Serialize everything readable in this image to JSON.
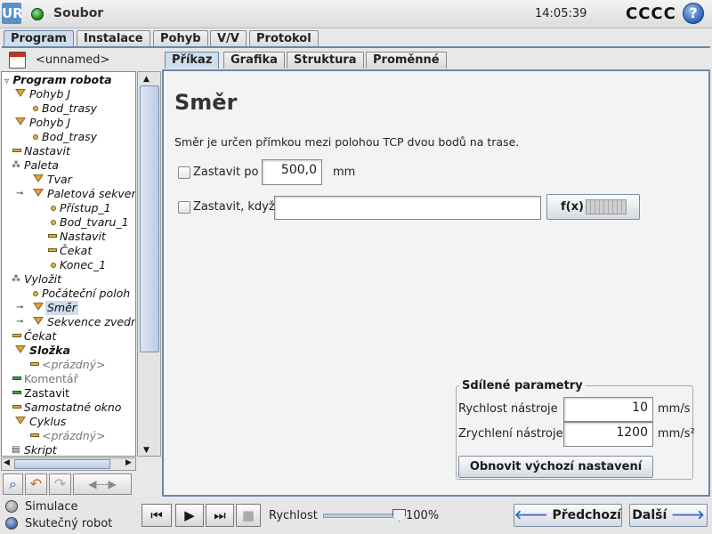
{
  "app": {
    "title": "Soubor",
    "clock": "14:05:39",
    "robot_name": "CCCC",
    "help": "?",
    "logo": "UR"
  },
  "main_tabs": [
    {
      "label": "Program",
      "active": true
    },
    {
      "label": "Instalace",
      "active": false
    },
    {
      "label": "Pohyb",
      "active": false
    },
    {
      "label": "V/V",
      "active": false
    },
    {
      "label": "Protokol",
      "active": false
    }
  ],
  "file": {
    "name": "<unnamed>"
  },
  "tree": [
    "Program robota",
    "Pohyb J",
    "Bod_trasy",
    "Pohyb J",
    "Bod_trasy",
    "Nastavit",
    "Paleta",
    "Tvar",
    "Paletová sekven",
    "Přístup_1",
    "Bod_tvaru_1",
    "Nastavit",
    "Čekat",
    "Konec_1",
    "Vyložit",
    "Počáteční poloh",
    "Směr",
    "Sekvence zvedn",
    "Čekat",
    "Složka",
    "<prázdný>",
    "Komentář",
    "Zastavit",
    "Samostatné okno",
    "Cyklus",
    "<prázdný>",
    "Skript"
  ],
  "sub_tabs": [
    {
      "label": "Příkaz",
      "active": true
    },
    {
      "label": "Grafika",
      "active": false
    },
    {
      "label": "Struktura",
      "active": false
    },
    {
      "label": "Proměnné",
      "active": false
    }
  ],
  "content": {
    "heading": "Směr",
    "description": "Směr je určen přímkou mezi polohou TCP dvou bodů na trase.",
    "stop_after_label": "Zastavit po",
    "stop_after_value": "500,0",
    "stop_after_unit": "mm",
    "stop_when_label": "Zastavit, když",
    "stop_when_value": "",
    "fx_label": "f(x)"
  },
  "shared": {
    "title": "Sdílené parametry",
    "tool_speed_label": "Rychlost nástroje",
    "tool_speed_value": "10",
    "tool_speed_unit": "mm/s",
    "tool_accel_label": "Zrychlení nástroje",
    "tool_accel_value": "1200",
    "tool_accel_unit": "mm/s²",
    "reset_label": "Obnovit výchozí nastavení"
  },
  "bottom": {
    "simulation": "Simulace",
    "real_robot": "Skutečný robot",
    "speed_label": "Rychlost",
    "speed_value": "100%",
    "prev": "Předchozí",
    "next": "Další"
  },
  "colors": {
    "accent": "#6d86a7",
    "selection": "#cfdcec"
  }
}
